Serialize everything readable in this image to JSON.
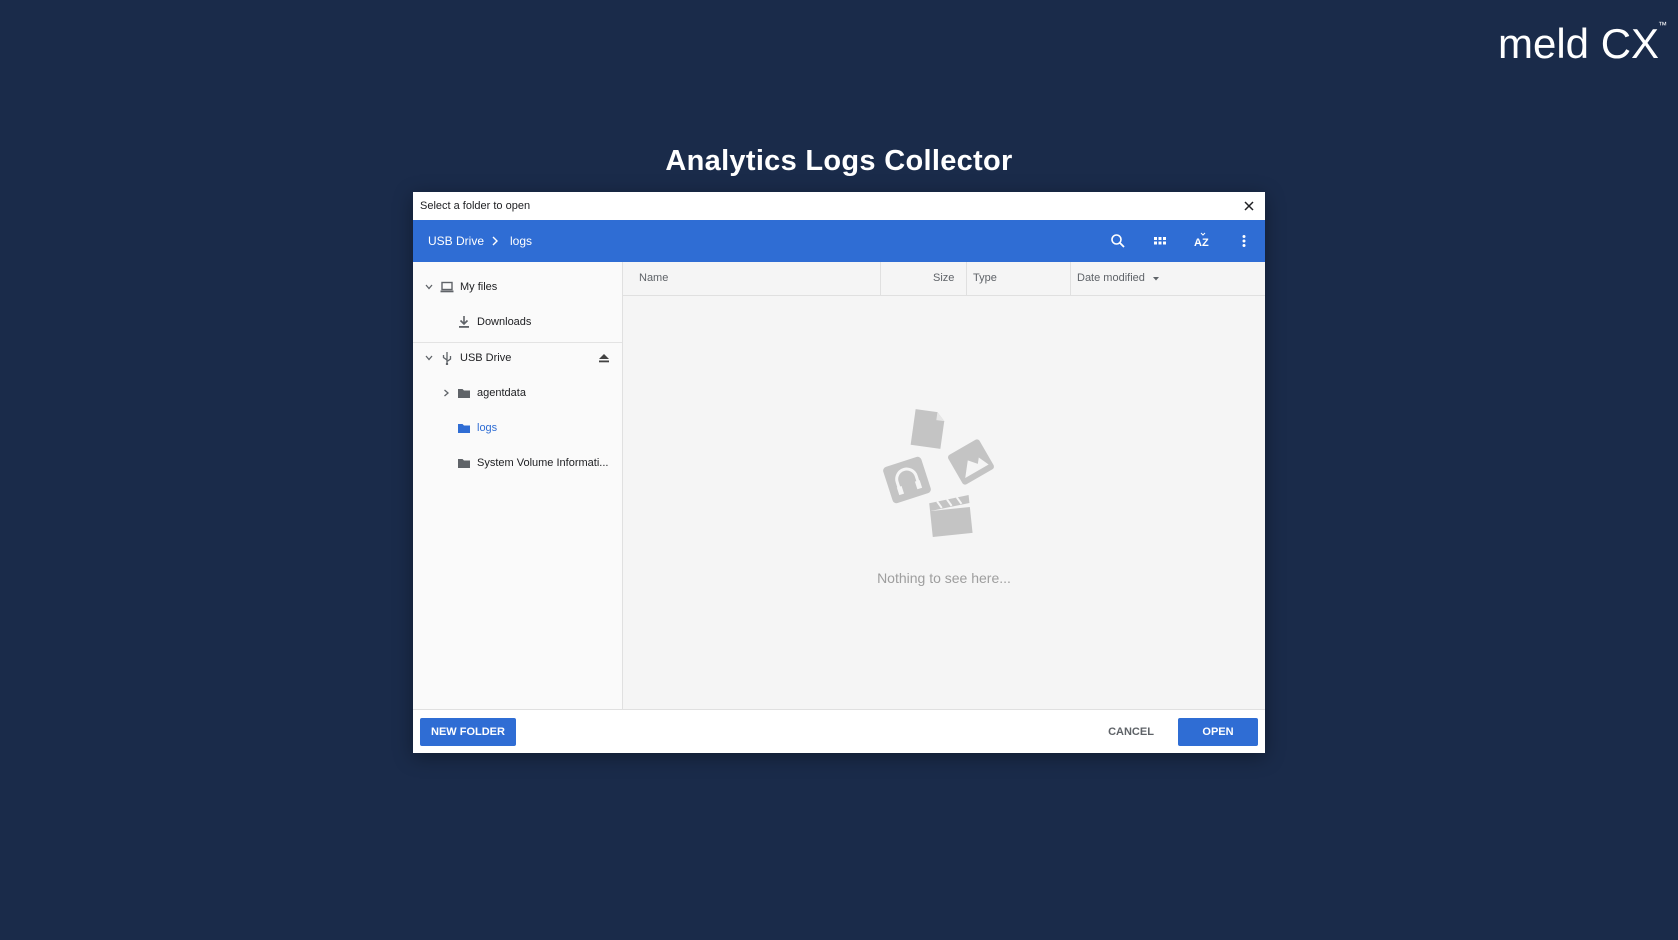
{
  "page": {
    "title": "Analytics Logs Collector",
    "logo_text": "meld CX",
    "logo_tm": "™"
  },
  "dialog": {
    "title": "Select a folder to open",
    "close_icon": "close-icon",
    "breadcrumb": [
      {
        "label": "USB Drive"
      },
      {
        "label": "logs"
      }
    ],
    "toolbar_icons": [
      "search-icon",
      "grid-view-icon",
      "sort-az-icon",
      "more-vert-icon"
    ],
    "sort_label": "AZ",
    "sidebar": {
      "my_files": "My files",
      "downloads": "Downloads",
      "usb_drive": "USB Drive",
      "folders": [
        {
          "label": "agentdata",
          "expandable": true
        },
        {
          "label": "logs",
          "selected": true
        },
        {
          "label": "System Volume Informati..."
        }
      ]
    },
    "columns": {
      "name": "Name",
      "size": "Size",
      "type": "Type",
      "date": "Date modified"
    },
    "empty_message": "Nothing to see here...",
    "buttons": {
      "new_folder": "NEW FOLDER",
      "cancel": "CANCEL",
      "open": "OPEN"
    }
  },
  "colors": {
    "background": "#1a2b4a",
    "accent": "#2f6dd4",
    "selected_text": "#2f6dd4"
  }
}
